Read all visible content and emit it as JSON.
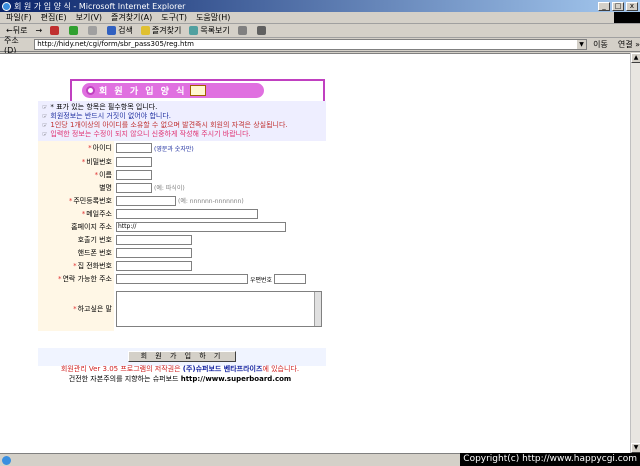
{
  "window": {
    "title": "회 원 가 입 양 식 - Microsoft Internet Explorer",
    "min": "_",
    "max": "□",
    "close": "x"
  },
  "menu": [
    "파일(F)",
    "편집(E)",
    "보기(V)",
    "즐겨찾기(A)",
    "도구(T)",
    "도움말(H)"
  ],
  "toolbar": {
    "back": "뒤로",
    "search": "검색",
    "favorites": "즐겨찾기",
    "history": "목록보기",
    "forward_arrow": "→",
    "back_arrow": "←"
  },
  "address": {
    "label": "주소(D)",
    "url": "http://hidy.net/cgi/form/sbr_pass305/reg.htm",
    "go": "이동",
    "links": "연결 »"
  },
  "page": {
    "banner_title": "회 원 가 입 양 식",
    "notices": [
      {
        "text": "* 표가 있는 항목은 필수항목 입니다.",
        "color": "#000000"
      },
      {
        "text": "회원정보는 반드시 거짓이 없어야 합니다.",
        "color": "#2030a0"
      },
      {
        "text": "1인당 1개이상의 아이디를 소유할 수 없으며 발견즉시 회원의 자격은 상실됩니다.",
        "color": "#c03030"
      },
      {
        "text": "입력한 정보는 수정이 되지 않으니 신중하게 작성해 주시기 바랍니다.",
        "color": "#e03070"
      }
    ],
    "fields": {
      "id": {
        "label": "아이디",
        "hint": "(영문과 숫자만)"
      },
      "password": {
        "label": "비밀번호"
      },
      "name": {
        "label": "이름"
      },
      "nickname": {
        "label": "별명",
        "hint": "(예: 따식이)"
      },
      "ssn": {
        "label": "주민등록번호",
        "hint": "(예: nnnnnn-nnnnnnn)"
      },
      "email": {
        "label": "메일주소"
      },
      "homepage": {
        "label": "홈페이지 주소",
        "value": "http://"
      },
      "pager": {
        "label": "호출기 번호"
      },
      "mobile": {
        "label": "핸드폰 번호"
      },
      "phone": {
        "label": "집 전화번호"
      },
      "address": {
        "label": "연락 가능한 주소",
        "zip_label": "우편번호"
      },
      "message": {
        "label": "하고싶은 말"
      }
    },
    "submit": "회 원 가 입 하 기",
    "footer_line1_pre": "회원관리 Ver 3.05 프로그램의 저작권은 ",
    "footer_company": "(주)슈퍼보드 벤타프라이즈",
    "footer_line1_post": "에 있습니다.",
    "footer_line2_pre": "건전한 자본주의를 지향하는 슈퍼보드 ",
    "footer_url": "http://www.superboard.com"
  },
  "status": {
    "copyright": "Copyright(c) http://www.happycgi.com"
  },
  "colors": {
    "banner": "#e070e0",
    "required": "#e03030"
  }
}
